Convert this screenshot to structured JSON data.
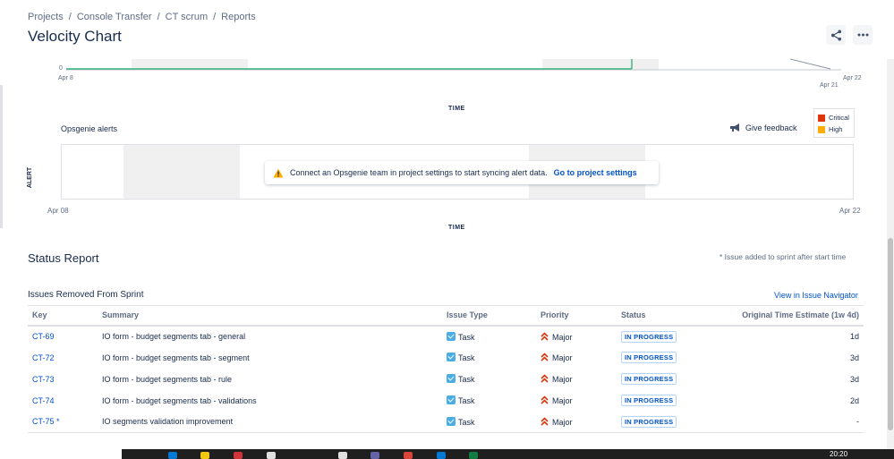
{
  "breadcrumb": [
    "Projects",
    "Console Transfer",
    "CT scrum",
    "Reports"
  ],
  "page_title": "Velocity Chart",
  "upper_chart": {
    "y_zero": "0",
    "start_date": "Apr 8",
    "end_date_a": "Apr 21",
    "end_date_b": "Apr 22",
    "time_label": "TIME"
  },
  "opsgenie": {
    "title": "Opsgenie alerts",
    "feedback": "Give feedback",
    "legend": [
      {
        "label": "Critical",
        "color": "#de350b"
      },
      {
        "label": "High",
        "color": "#ffab00"
      }
    ],
    "y_label": "ALERT",
    "message": "Connect an Opsgenie team in project settings to start syncing alert data.",
    "link": "Go to project settings",
    "start_date": "Apr 08",
    "end_date": "Apr 22",
    "time_label": "TIME"
  },
  "status_report": {
    "title": "Status Report",
    "note": "* Issue added to sprint after start time"
  },
  "removed": {
    "title": "Issues Removed From Sprint",
    "view_link": "View in Issue Navigator",
    "columns": [
      "Key",
      "Summary",
      "Issue Type",
      "Priority",
      "Status",
      "Original Time Estimate (1w 4d)"
    ],
    "rows": [
      {
        "key": "CT-69",
        "summary": "IO form - budget segments tab - general",
        "type": "Task",
        "priority": "Major",
        "status": "IN PROGRESS",
        "estimate": "1d"
      },
      {
        "key": "CT-72",
        "summary": "IO form - budget segments tab - segment",
        "type": "Task",
        "priority": "Major",
        "status": "IN PROGRESS",
        "estimate": "3d"
      },
      {
        "key": "CT-73",
        "summary": "IO form - budget segments tab - rule",
        "type": "Task",
        "priority": "Major",
        "status": "IN PROGRESS",
        "estimate": "3d"
      },
      {
        "key": "CT-74",
        "summary": "IO form - budget segments tab - validations",
        "type": "Task",
        "priority": "Major",
        "status": "IN PROGRESS",
        "estimate": "2d"
      },
      {
        "key": "CT-75 *",
        "summary": "IO segments validation improvement",
        "type": "Task",
        "priority": "Major",
        "status": "IN PROGRESS",
        "estimate": "-"
      }
    ]
  },
  "taskbar": {
    "clock": "20:20"
  },
  "colors": {
    "accent": "#0052cc",
    "chart_line": "#36b37e",
    "priority_major": "#de350b"
  }
}
